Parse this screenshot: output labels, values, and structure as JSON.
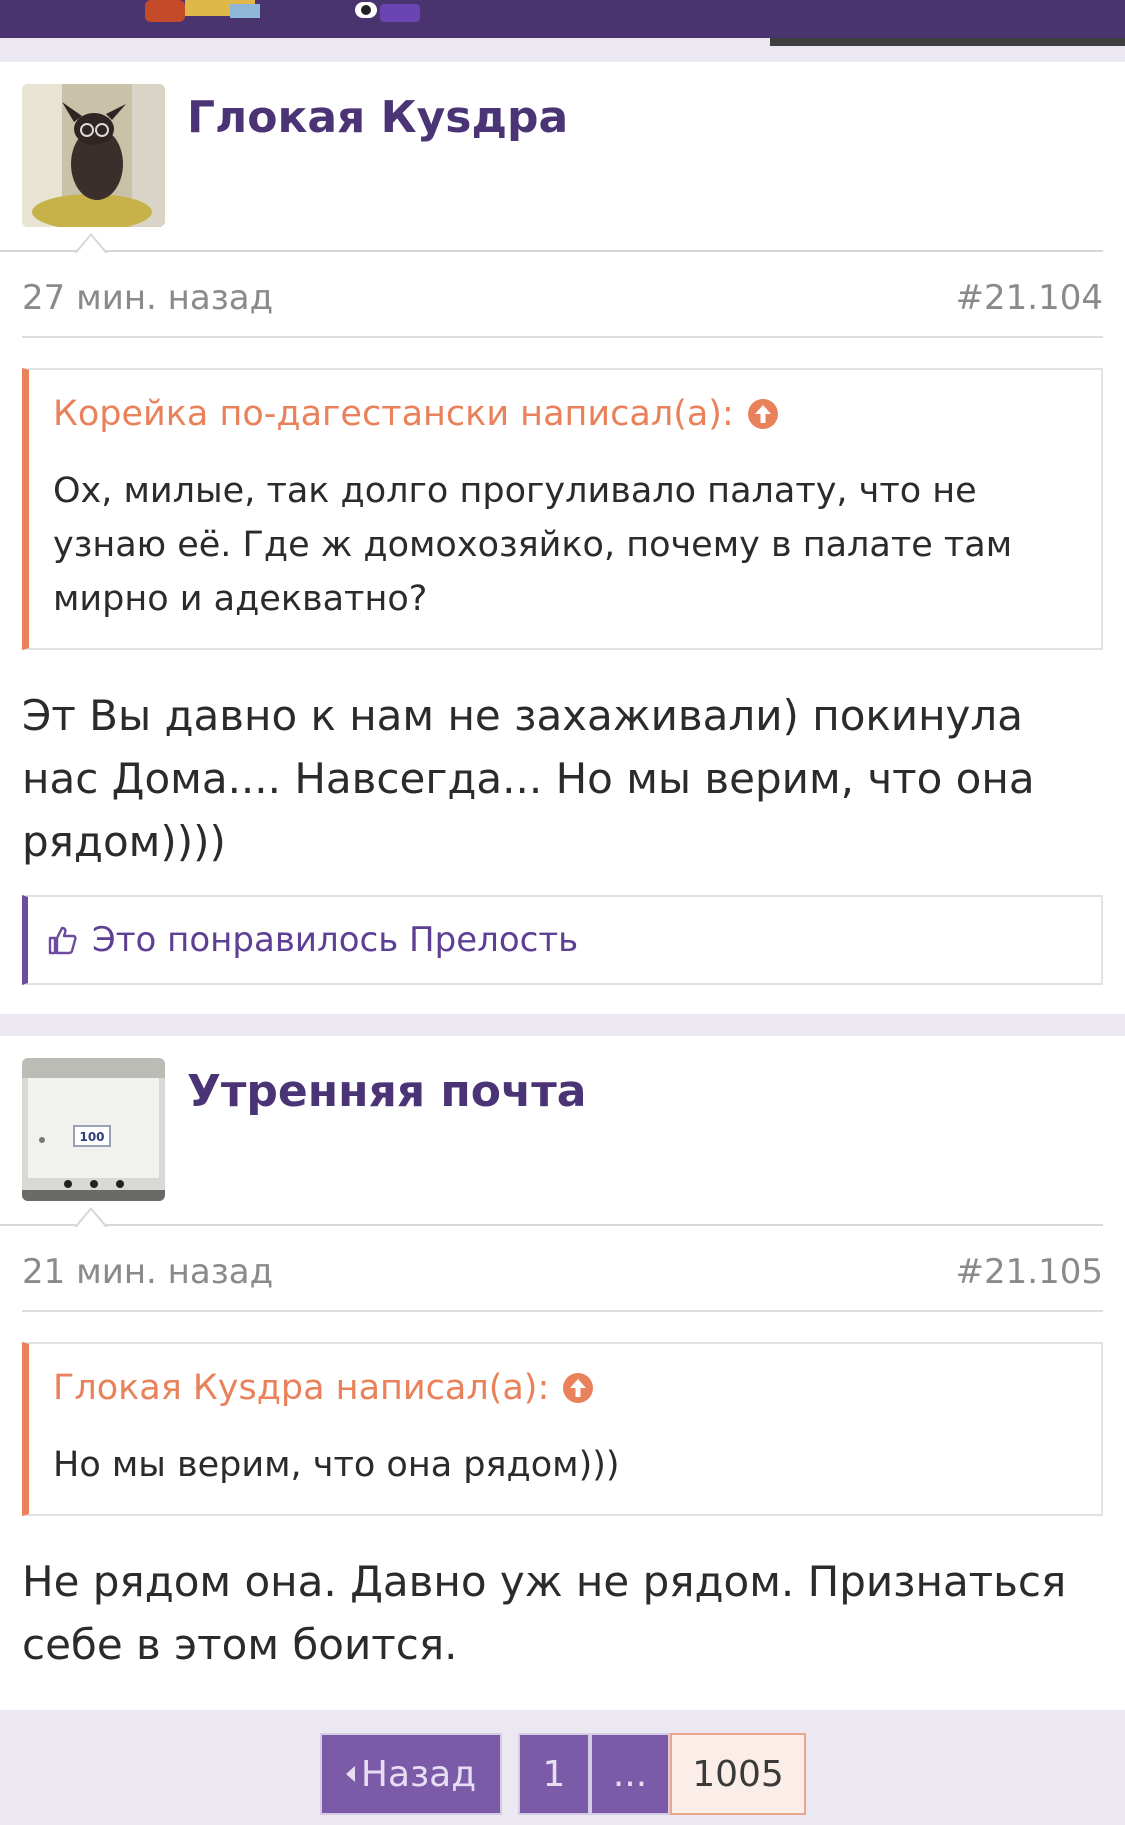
{
  "posts": [
    {
      "username": "Глокая Куsдра",
      "avatar_icon": "cat-with-glasses-avatar",
      "time": "27 мин. назад",
      "post_number": "#21.104",
      "quote": {
        "author_line": "Корейка по-дагестански написал(а):",
        "text": "Ох, милые, так долго прогуливало палату, что не узнаю её. Где ж домохозяйко, почему в палате там мирно и адекватно?"
      },
      "message": "Эт Вы давно к нам не захаживали) покинула нас Дома.... Навсегда... Но мы верим, что она рядом))))",
      "likes": "Это понравилось Прелость"
    },
    {
      "username": "Утренняя почта",
      "avatar_icon": "mailbox-avatar",
      "avatar_text": "100",
      "time": "21 мин. назад",
      "post_number": "#21.105",
      "quote": {
        "author_line": "Глокая Куsдра написал(а):",
        "text": "Но мы верим, что она рядом)))"
      },
      "message": "Не рядом она. Давно уж не рядом. Признаться себе в этом боится."
    }
  ],
  "pagination": {
    "prev_label": "Назад",
    "pages": [
      "1",
      "...",
      "1005"
    ],
    "current": "1005"
  },
  "colors": {
    "header": "#4a3470",
    "username": "#4b3475",
    "quote_accent": "#e9815b",
    "likes_accent": "#6c4ba0",
    "pager_button": "#7b5ba8"
  }
}
